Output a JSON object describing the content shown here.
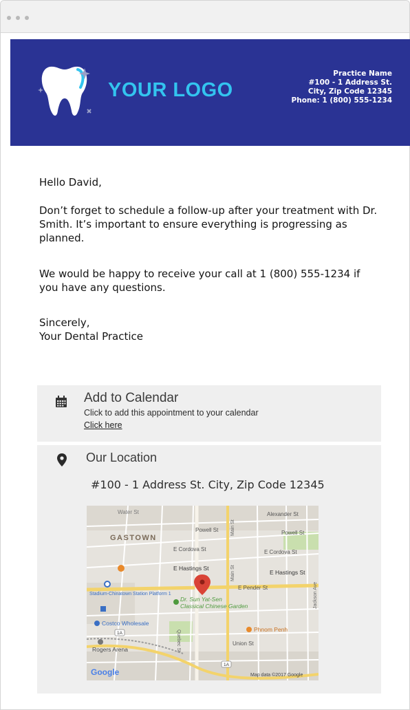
{
  "window": {
    "controls": [
      "close-dot",
      "minimize-dot",
      "zoom-dot"
    ]
  },
  "header": {
    "logo_text": "YOUR LOGO",
    "practice_name": "Practice Name",
    "address_line1": "#100 - 1 Address St.",
    "address_line2": "City, Zip Code 12345",
    "phone": "Phone: 1 (800) 555-1234",
    "colors": {
      "background": "#2a3394",
      "logo": "#33c4ef",
      "text": "#ffffff"
    }
  },
  "email": {
    "greeting": "Hello David,",
    "paragraph1": "Don’t forget to schedule a follow-up after your treatment with Dr. Smith. It’s important to ensure everything is progressing as planned.",
    "paragraph2": "We would be happy to receive your call at 1 (800) 555-1234 if you have any questions.",
    "signoff": "Sincerely,",
    "signature": "Your Dental Practice"
  },
  "calendar": {
    "icon": "calendar-icon",
    "title": "Add to Calendar",
    "subtitle": "Click to add this appointment to your calendar",
    "link_text": "Click here"
  },
  "location": {
    "icon": "map-pin-icon",
    "title": "Our Location",
    "address": "#100 - 1 Address St. City, Zip Code 12345"
  },
  "map": {
    "neighborhood": "GASTOWN",
    "streets": {
      "water": "Water St",
      "powell1": "Powell St",
      "powell2": "Powell St",
      "alexander": "Alexander St",
      "cordova1": "E Cordova St",
      "cordova2": "E Cordova St",
      "hastings1": "E Hastings St",
      "hastings2": "E Hastings St",
      "pender": "E Pender St",
      "main1": "Main St",
      "main2": "Main St",
      "jackson": "Jackson Ave",
      "quebec": "Quebec St",
      "union": "Union St"
    },
    "pois": {
      "stadium": "Stadium-Chinatown Station Platform 1",
      "garden_line1": "Dr. Sun Yat-Sen",
      "garden_line2": "Classical Chinese Garden",
      "costco": "Costco Wholesale",
      "arena": "Rogers Arena",
      "phnom": "Phnom Penh"
    },
    "brand": "Google",
    "attribution": "Map data ©2017 Google",
    "route_badge": "1A"
  }
}
